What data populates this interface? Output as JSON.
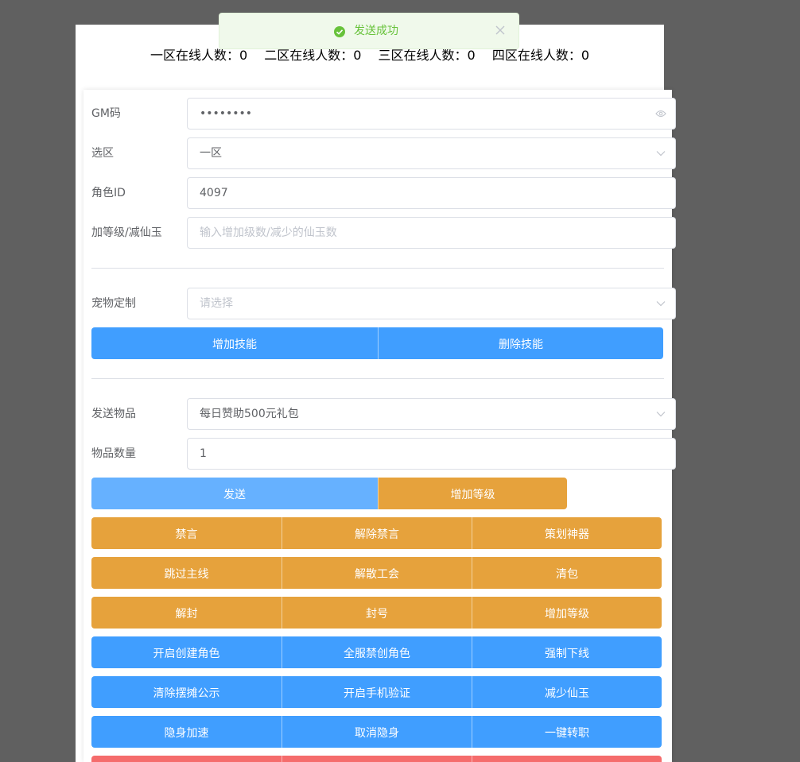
{
  "toast": {
    "message": "发送成功"
  },
  "online": [
    {
      "label": "一区在线人数：0"
    },
    {
      "label": "二区在线人数：0"
    },
    {
      "label": "三区在线人数：0"
    },
    {
      "label": "四区在线人数：0"
    }
  ],
  "form": {
    "gm_code": {
      "label": "GM码",
      "value": "••••••••"
    },
    "zone": {
      "label": "选区",
      "value": "一区"
    },
    "role_id": {
      "label": "角色ID",
      "value": "4097"
    },
    "level": {
      "label": "加等级/减仙玉",
      "placeholder": "输入增加级数/减少的仙玉数"
    },
    "pet": {
      "label": "宠物定制",
      "placeholder": "请选择"
    },
    "item": {
      "label": "发送物品",
      "value": "每日赞助500元礼包"
    },
    "quantity": {
      "label": "物品数量",
      "value": "1"
    }
  },
  "buttons": {
    "skill": [
      "增加技能",
      "删除技能"
    ],
    "send": [
      "发送",
      "增加等级"
    ],
    "row1": [
      "禁言",
      "解除禁言",
      "策划神器"
    ],
    "row2": [
      "跳过主线",
      "解散工会",
      "清包"
    ],
    "row3": [
      "解封",
      "封号",
      "增加等级"
    ],
    "row4": [
      "开启创建角色",
      "全服禁创角色",
      "强制下线"
    ],
    "row5": [
      "清除摆摊公示",
      "开启手机验证",
      "减少仙玉"
    ],
    "row6": [
      "隐身加速",
      "取消隐身",
      "一键转职"
    ],
    "row7": [
      "",
      "",
      ""
    ]
  },
  "colors": {
    "primary": "#409eff",
    "primary_light": "#66b1ff",
    "warning": "#e6a23c",
    "danger": "#f56c6c",
    "success": "#67c23a"
  }
}
